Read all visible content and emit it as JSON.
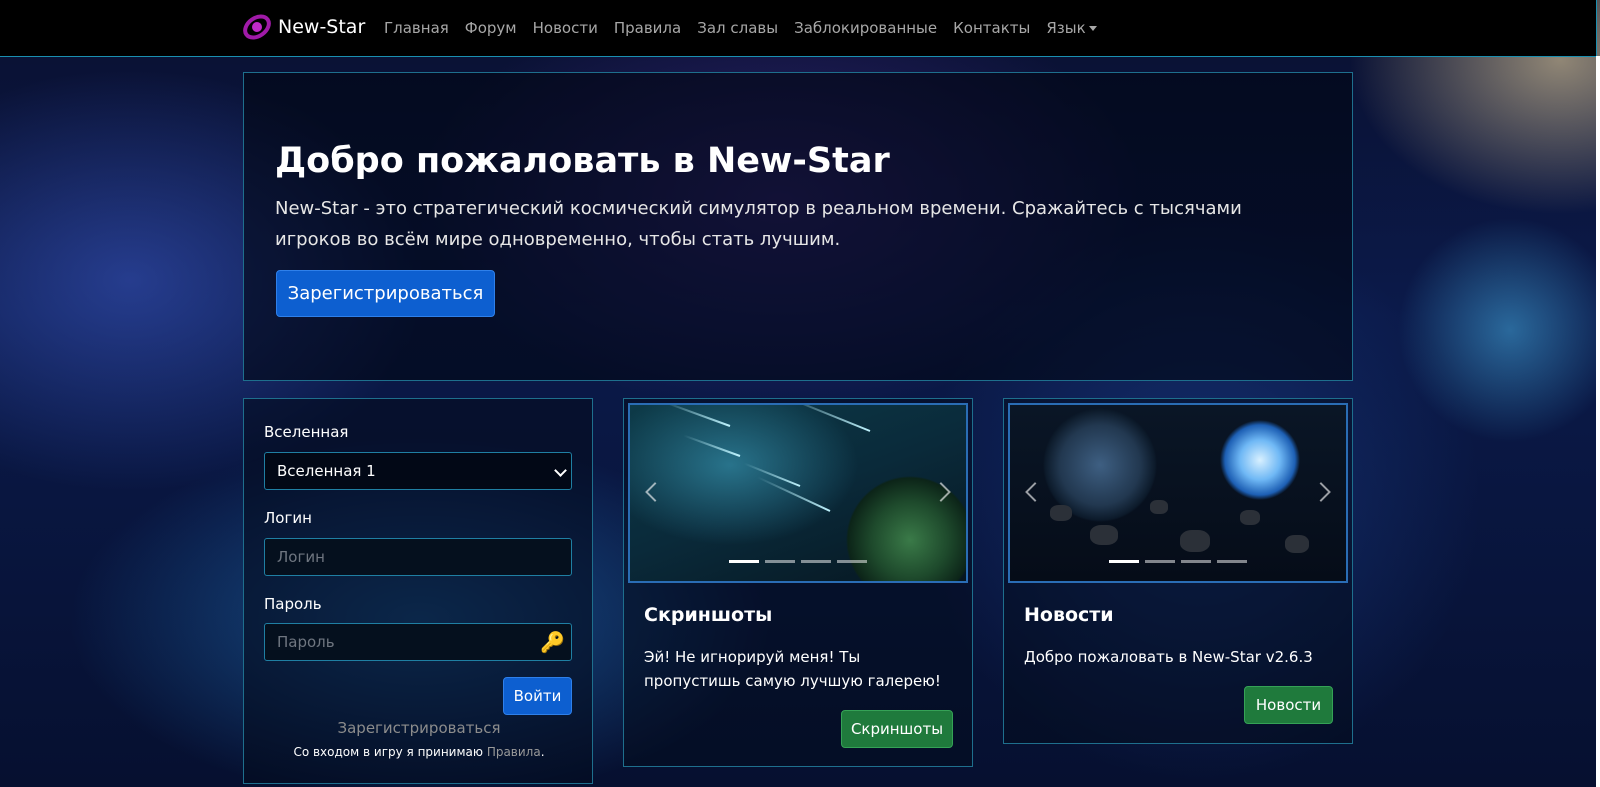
{
  "navbar": {
    "brand": "New-Star",
    "links": [
      "Главная",
      "Форум",
      "Новости",
      "Правила",
      "Зал славы",
      "Заблокированные",
      "Контакты",
      "Язык"
    ]
  },
  "hero": {
    "title": "Добро пожаловать в New-Star",
    "description": "New-Star - это стратегический космический симулятор в реальном времени. Сражайтесь с тысячами игроков во всём мире одновременно, чтобы стать лучшим.",
    "register_button": "Зарегистрироваться"
  },
  "login": {
    "universe_label": "Вселенная",
    "universe_selected": "Вселенная 1",
    "login_label": "Логин",
    "login_placeholder": "Логин",
    "password_label": "Пароль",
    "password_placeholder": "Пароль",
    "submit_button": "Войти",
    "register_link": "Зарегистрироваться",
    "accept_text": "Со входом в игру я принимаю",
    "rules_link": "Правила",
    "accept_end": "."
  },
  "screenshots_card": {
    "title": "Скриншоты",
    "text": "Эй! Не игнорируй меня! Ты пропустишь самую лучшую галерею!",
    "button": "Скриншоты"
  },
  "news_card": {
    "title": "Новости",
    "text": "Добро пожаловать в New-Star v2.6.3",
    "button": "Новости"
  },
  "icons": {
    "brand": "galaxy-logo-icon",
    "password": "key-icon",
    "select": "chevron-down-icon",
    "carousel_prev": "chevron-left-icon",
    "carousel_next": "chevron-right-icon",
    "language": "caret-down-icon"
  },
  "colors": {
    "primary": "#0d5fd0",
    "success": "#1f7a3c",
    "border_accent": "#1e6f8d",
    "navbar_bg": "#000000"
  }
}
